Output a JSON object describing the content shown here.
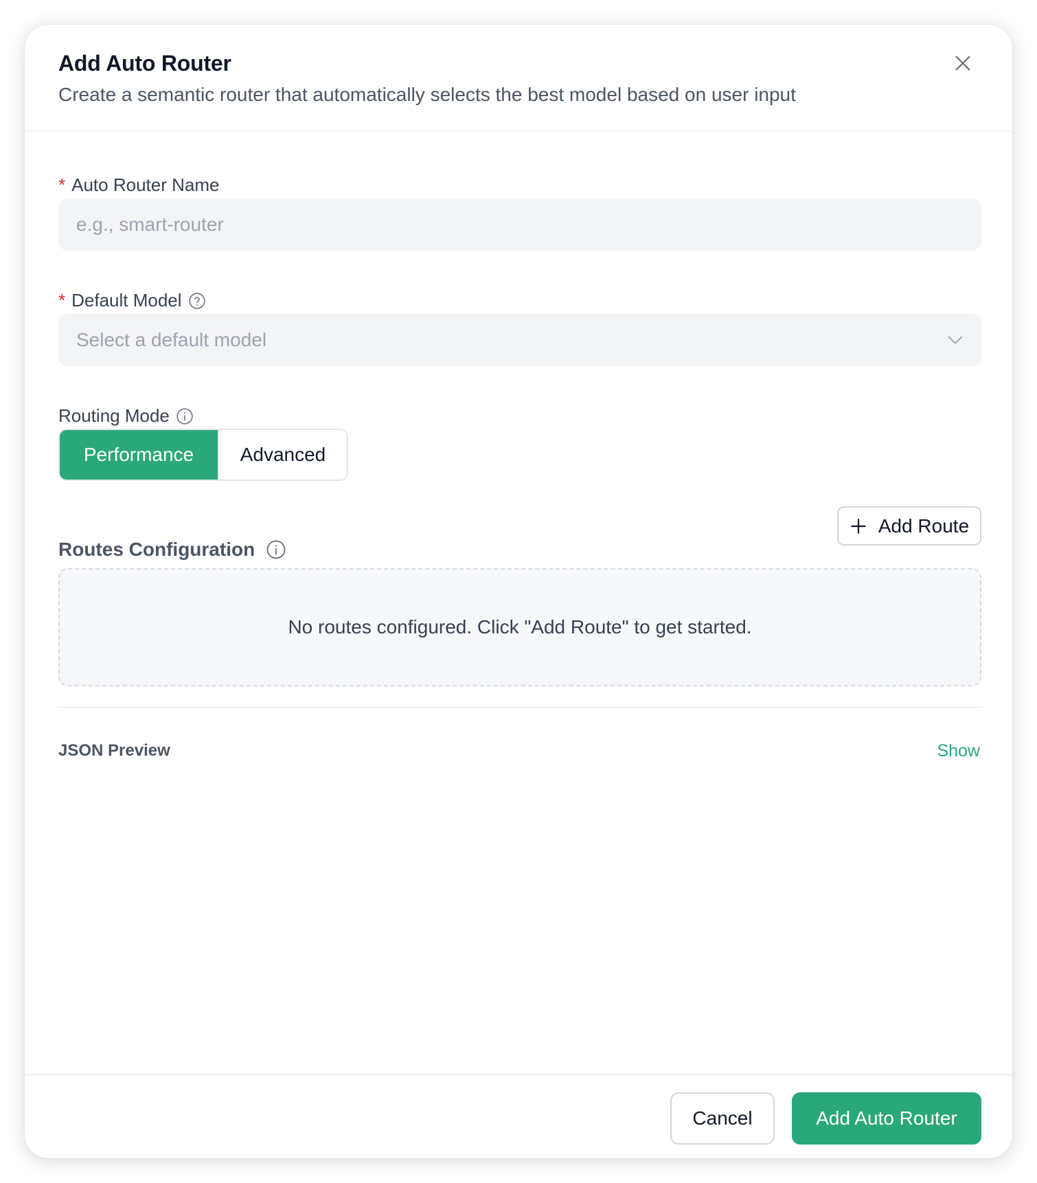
{
  "dialog": {
    "title": "Add Auto Router",
    "subtitle": "Create a semantic router that automatically selects the best model based on user input"
  },
  "form": {
    "name": {
      "required_mark": "*",
      "label": "Auto Router Name",
      "placeholder": "e.g., smart-router"
    },
    "default_model": {
      "required_mark": "*",
      "label": "Default Model",
      "placeholder": "Select a default model"
    },
    "routing_mode": {
      "label": "Routing Mode",
      "options": [
        "Performance",
        "Advanced"
      ],
      "selected": "Performance"
    },
    "routes": {
      "title": "Routes Configuration",
      "add_button": "Add Route",
      "empty_message": "No routes configured. Click \"Add Route\" to get started."
    },
    "json_preview": {
      "label": "JSON Preview",
      "toggle": "Show"
    }
  },
  "footer": {
    "cancel": "Cancel",
    "submit": "Add Auto Router"
  },
  "colors": {
    "accent": "#2aa87a",
    "required": "#dc2626"
  },
  "icons": [
    "close-icon",
    "help-circle-icon",
    "info-circle-icon",
    "chevron-down-icon",
    "plus-icon"
  ]
}
